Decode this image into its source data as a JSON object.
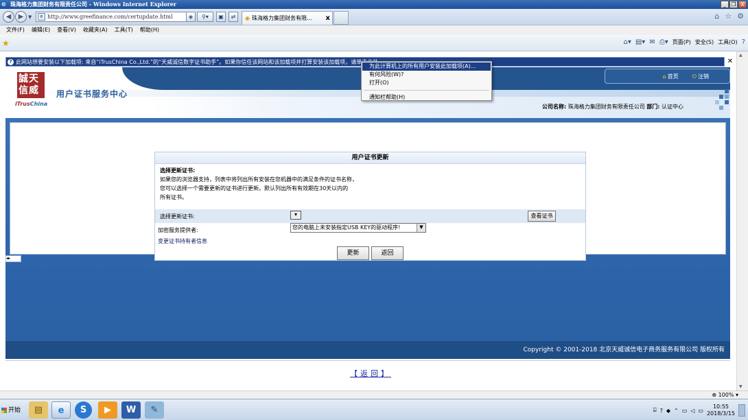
{
  "window": {
    "title": "珠海格力集团财务有限责任公司 - Windows Internet Explorer",
    "minimize": "_",
    "restore": "❐",
    "close": "X"
  },
  "address": {
    "url": "http://www.greefinance.com/certupdate.html",
    "tab_title": "珠海格力集团财务有限...",
    "tab_close": "x"
  },
  "menu": {
    "items": [
      "文件(F)",
      "编辑(E)",
      "查看(V)",
      "收藏夹(A)",
      "工具(T)",
      "帮助(H)"
    ]
  },
  "commandbar": {
    "page": "页面(P)",
    "safety": "安全(S)",
    "tools": "工具(O)",
    "help": "?"
  },
  "infobar": {
    "text": "此网站想要安装以下加载项: 来自“iTrusChina Co.,Ltd.”的“天威诚信数字证书助手”。如果你信任该网站和该加载项并打算安装该加载项，请单击此处..."
  },
  "context_menu": {
    "items": [
      "为此计算机上的所有用户安装此加载项(A)...",
      "有何风险(W)?",
      "打开(O)",
      "通知栏帮助(H)"
    ]
  },
  "site": {
    "logo_chars": "誠天信威",
    "logo_brand_a": "iTrus",
    "logo_brand_b": "China",
    "title": "用户证书服务中心",
    "home": "首页",
    "logout": "注销",
    "company_label": "公司名称:",
    "company_name": "珠海格力集团财务有限责任公司",
    "dept_label": "部门:",
    "dept_name": "认证中心"
  },
  "form": {
    "heading": "用户证书更新",
    "intro_title": "选择更新证书:",
    "intro_lines": [
      "如果您的浏览器支持，列表中将列出所有安装在您机器中的满足条件的证书名称，",
      "您可以选择一个需要更新的证书进行更新。默认列出所有有效期在30天以内的",
      "所有证书。"
    ],
    "select_label": "选择更新证书:",
    "view_button": "查看证书",
    "provider_label": "加密服务提供者:",
    "provider_value": "您的电脑上未安装指定USB KEY的驱动程序!",
    "change_link": "变更证书持有者信息",
    "update_button": "更新",
    "back_button": "返回"
  },
  "footer": {
    "copyright": "Copyright © 2001-2018 北京天威诚信电子商务服务有限公司 版权所有",
    "back_link": "【返回】"
  },
  "status": {
    "zoom": "100%"
  },
  "taskbar": {
    "start": "开始",
    "time": "10:55",
    "date": "2018/3/15"
  }
}
